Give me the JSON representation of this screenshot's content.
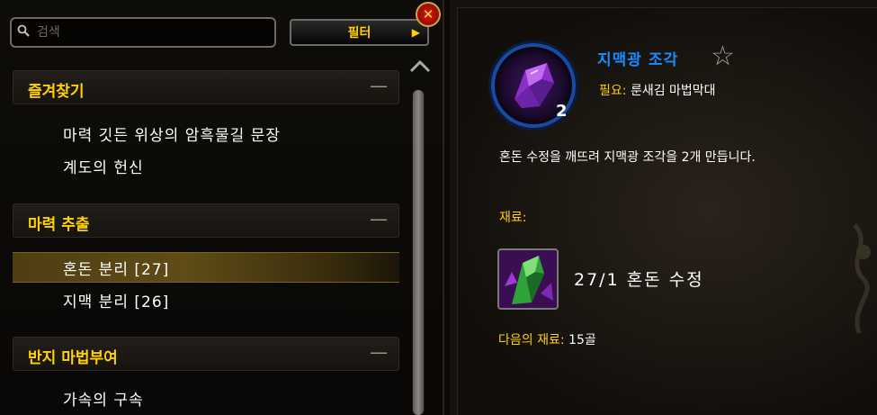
{
  "search": {
    "placeholder": "검색",
    "value": ""
  },
  "filter_label": "필터",
  "categories": [
    {
      "label": "즐겨찾기",
      "toggle": "—",
      "recipes": [
        "마력 깃든 위상의 암흑물길 문장",
        "계도의 헌신"
      ]
    },
    {
      "label": "마력 추출",
      "toggle": "—",
      "recipes": [
        "혼돈 분리 [27]",
        "지맥 분리 [26]"
      ]
    },
    {
      "label": "반지 마법부여",
      "toggle": "—",
      "recipes": [
        "가속의 구속"
      ]
    }
  ],
  "selected_recipe": "혼돈 분리 [27]",
  "detail": {
    "item_name": "지맥광 조각",
    "item_count": "2",
    "requires_label": "필요:",
    "requires_value": "룬새김 마법막대",
    "description": "혼돈 수정을 깨뜨려 지맥광 조각을 2개 만듭니다.",
    "materials_label": "재료:",
    "reagent_text": "27/1  혼돈 수정",
    "cost_label": "다음의 재료:",
    "cost_value": "15골"
  },
  "colors": {
    "category_text": "#ffd200",
    "item_name": "#1a8cff",
    "selection": "#5f4c16",
    "close_button": "#d61a0f"
  },
  "icons": {
    "search": "search-icon",
    "close": "close-icon",
    "favorite": "star-outline-icon",
    "item": "purple-crystal-icon",
    "reagent": "green-crystal-icon"
  }
}
